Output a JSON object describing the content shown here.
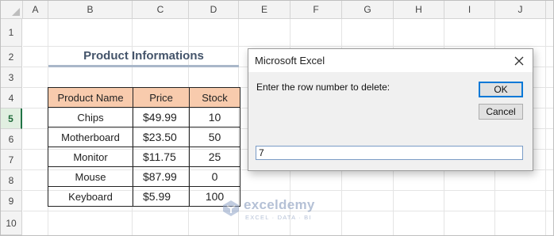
{
  "spreadsheet": {
    "columns": [
      "A",
      "B",
      "C",
      "D",
      "E",
      "F",
      "G",
      "H",
      "I",
      "J"
    ],
    "rows": [
      "1",
      "2",
      "3",
      "4",
      "5",
      "6",
      "7",
      "8",
      "9",
      "10"
    ],
    "active_row": "5",
    "title": "Product Informations",
    "table": {
      "headers": [
        "Product Name",
        "Price",
        "Stock"
      ],
      "rows": [
        [
          "Chips",
          "$49.99",
          "10"
        ],
        [
          "Motherboard",
          "$23.50",
          "50"
        ],
        [
          "Monitor",
          "$11.75",
          "25"
        ],
        [
          "Mouse",
          "$87.99",
          "0"
        ],
        [
          "Keyboard",
          "$5.99",
          "100"
        ]
      ]
    }
  },
  "dialog": {
    "title": "Microsoft Excel",
    "prompt": "Enter the row number to delete:",
    "ok_label": "OK",
    "cancel_label": "Cancel",
    "input_value": "7"
  },
  "watermark": {
    "name": "exceldemy",
    "tagline": "EXCEL · DATA · BI"
  },
  "colors": {
    "header_fill": "#f8cbad",
    "title_color": "#44546a",
    "active_row_green": "#217346",
    "ok_border": "#0078d7"
  },
  "icons": {
    "close": "close-icon",
    "logo": "exceldemy-logo-icon"
  }
}
